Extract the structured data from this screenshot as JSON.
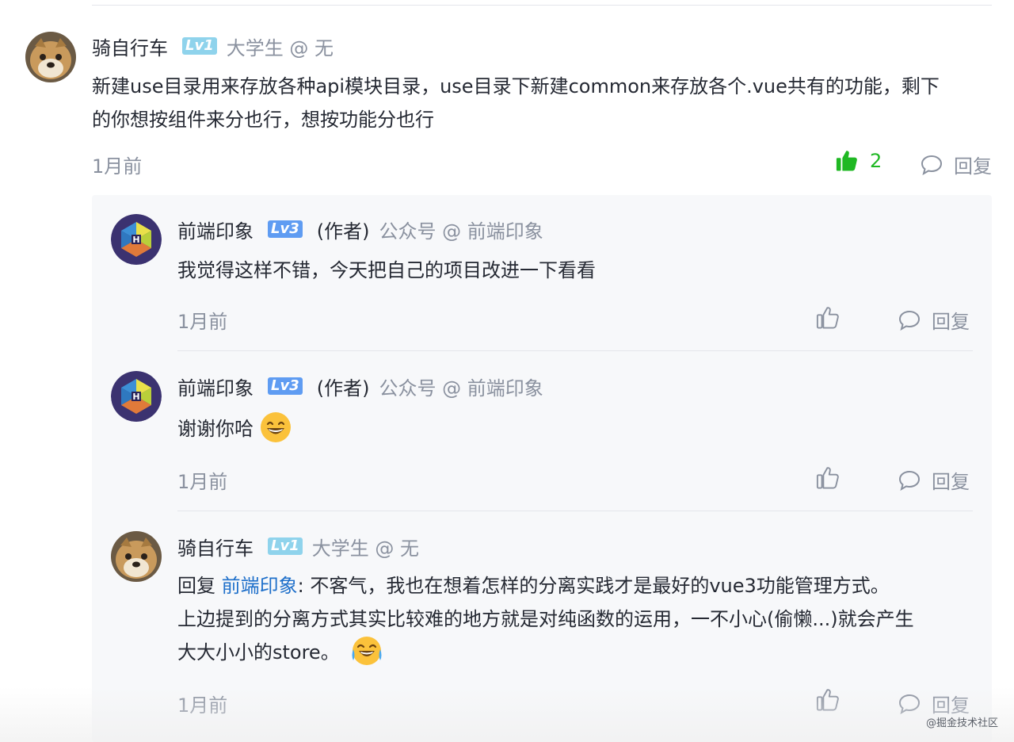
{
  "comment": {
    "user": "骑自行车",
    "level": "Lv1",
    "job": "大学生 @ 无",
    "text_line1": "新建use目录用来存放各种api模块目录，use目录下新建common来存放各个.vue共有的功能，剩下",
    "text_line2": "的你想按组件来分也行，想按功能分也行",
    "time": "1月前",
    "like_count": "2",
    "reply_label": "回复"
  },
  "replies": [
    {
      "user": "前端印象",
      "level": "Lv3",
      "author_tag": "(作者)",
      "job": "公众号 @ 前端印象",
      "text": "我觉得这样不错，今天把自己的项目改进一下看看",
      "time": "1月前",
      "reply_label": "回复"
    },
    {
      "user": "前端印象",
      "level": "Lv3",
      "author_tag": "(作者)",
      "job": "公众号 @ 前端印象",
      "text": "谢谢你哈",
      "emoji": "grinning-face-icon",
      "time": "1月前",
      "reply_label": "回复"
    },
    {
      "user": "骑自行车",
      "level": "Lv1",
      "job": "大学生 @ 无",
      "reply_prefix": "回复",
      "reply_to": "前端印象",
      "text_line1": ": 不客气，我也在想着怎样的分离实践才是最好的vue3功能管理方式。",
      "text_line2": "上边提到的分离方式其实比较难的地方就是对纯函数的运用，一不小心(偷懒...)就会产生",
      "text_line3": "大大小小的store。",
      "emoji": "tears-of-joy-icon",
      "time": "1月前",
      "reply_label": "回复"
    }
  ],
  "watermark": "@掘金技术社区",
  "colors": {
    "liked": "#1fb823",
    "muted": "#8a919f",
    "link": "#1e6fca",
    "sub_bg": "#f7f8fa",
    "lv1": "#8fd3ec",
    "lv3": "#5f9cf2"
  }
}
